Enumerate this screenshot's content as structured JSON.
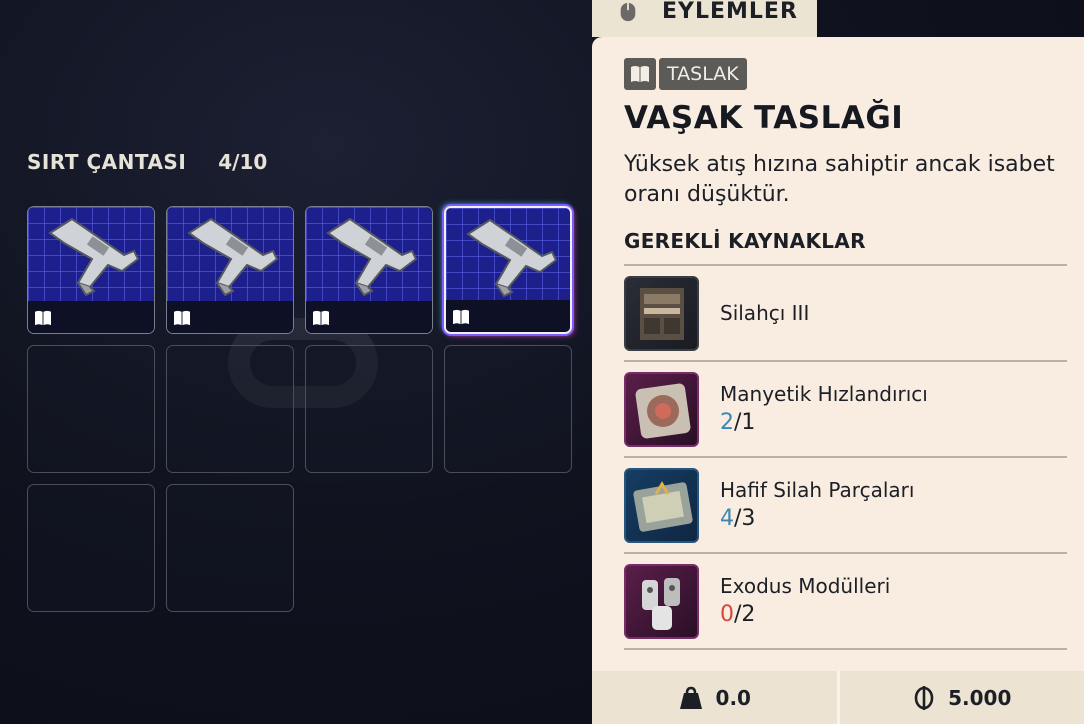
{
  "backpack": {
    "title": "SIRT ÇANTASI",
    "count": "4/10",
    "slots": [
      {
        "filled": true,
        "icon": "rifle-blueprint",
        "selected": false
      },
      {
        "filled": true,
        "icon": "rifle-blueprint",
        "selected": false
      },
      {
        "filled": true,
        "icon": "rifle-blueprint",
        "selected": false
      },
      {
        "filled": true,
        "icon": "rifle-blueprint",
        "selected": true
      },
      {
        "filled": false
      },
      {
        "filled": false
      },
      {
        "filled": false
      },
      {
        "filled": false
      },
      {
        "filled": false
      },
      {
        "filled": false
      }
    ]
  },
  "actions_tab": {
    "label": "EYLEMLER",
    "icon": "mouse-icon"
  },
  "item": {
    "tag_icon": "book-icon",
    "tag": "TASLAK",
    "name": "VAŞAK TASLAĞI",
    "description": "Yüksek atış hızına sahiptir ancak isabet oranı düşüktür."
  },
  "requirements": {
    "title": "GEREKLİ KAYNAKLAR",
    "items": [
      {
        "name": "Silahçı III",
        "have": "",
        "need": "",
        "thumb": "workbench",
        "rarity": "grey"
      },
      {
        "name": "Manyetik Hızlandırıcı",
        "have": "2",
        "need": "/1",
        "thumb": "magnetic-device",
        "rarity": "pink",
        "status": "ok"
      },
      {
        "name": "Hafif Silah Parçaları",
        "have": "4",
        "need": "/3",
        "thumb": "parts-case",
        "rarity": "blue",
        "status": "ok"
      },
      {
        "name": "Exodus Modülleri",
        "have": "0",
        "need": "/2",
        "thumb": "modules",
        "rarity": "pink",
        "status": "low"
      }
    ]
  },
  "footer": {
    "weight": "0.0",
    "price": "5.000",
    "weight_icon": "weight-icon",
    "currency_icon": "coin-icon"
  },
  "colors": {
    "accent_ok": "#3d86b3",
    "accent_low": "#d9443b",
    "panel_bg": "#f8ede0"
  }
}
